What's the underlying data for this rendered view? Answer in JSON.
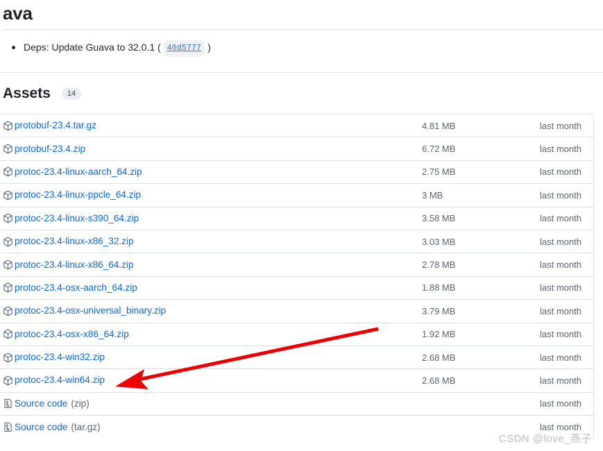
{
  "release_notes": {
    "title": "ava",
    "items": [
      {
        "text": "Deps: Update Guava to 32.0.1",
        "open_paren": "(",
        "commit": "40d5777",
        "close_paren": ")"
      }
    ]
  },
  "assets": {
    "heading": "Assets",
    "count": "14",
    "rows": [
      {
        "icon": "package-icon",
        "name": "protobuf-23.4.tar.gz",
        "suffix": "",
        "size": "4.81 MB",
        "date": "last month"
      },
      {
        "icon": "package-icon",
        "name": "protobuf-23.4.zip",
        "suffix": "",
        "size": "6.72 MB",
        "date": "last month"
      },
      {
        "icon": "package-icon",
        "name": "protoc-23.4-linux-aarch_64.zip",
        "suffix": "",
        "size": "2.75 MB",
        "date": "last month"
      },
      {
        "icon": "package-icon",
        "name": "protoc-23.4-linux-ppcle_64.zip",
        "suffix": "",
        "size": "3 MB",
        "date": "last month"
      },
      {
        "icon": "package-icon",
        "name": "protoc-23.4-linux-s390_64.zip",
        "suffix": "",
        "size": "3.58 MB",
        "date": "last month"
      },
      {
        "icon": "package-icon",
        "name": "protoc-23.4-linux-x86_32.zip",
        "suffix": "",
        "size": "3.03 MB",
        "date": "last month"
      },
      {
        "icon": "package-icon",
        "name": "protoc-23.4-linux-x86_64.zip",
        "suffix": "",
        "size": "2.78 MB",
        "date": "last month"
      },
      {
        "icon": "package-icon",
        "name": "protoc-23.4-osx-aarch_64.zip",
        "suffix": "",
        "size": "1.88 MB",
        "date": "last month"
      },
      {
        "icon": "package-icon",
        "name": "protoc-23.4-osx-universal_binary.zip",
        "suffix": "",
        "size": "3.79 MB",
        "date": "last month"
      },
      {
        "icon": "package-icon",
        "name": "protoc-23.4-osx-x86_64.zip",
        "suffix": "",
        "size": "1.92 MB",
        "date": "last month"
      },
      {
        "icon": "package-icon",
        "name": "protoc-23.4-win32.zip",
        "suffix": "",
        "size": "2.68 MB",
        "date": "last month"
      },
      {
        "icon": "package-icon",
        "name": "protoc-23.4-win64.zip",
        "suffix": "",
        "size": "2.68 MB",
        "date": "last month"
      },
      {
        "icon": "file-code-icon",
        "name": "Source code",
        "suffix": "(zip)",
        "size": "",
        "date": "last month"
      },
      {
        "icon": "file-code-icon",
        "name": "Source code",
        "suffix": "(tar.gz)",
        "size": "",
        "date": "last month"
      }
    ]
  },
  "annotation": {
    "arrow_color": "#ee0000",
    "points_at": "protoc-23.4-win64.zip"
  },
  "watermark": {
    "text": "CSDN @love_燕子"
  },
  "colors": {
    "link": "#0969da",
    "muted": "#59636e",
    "border": "#d8dee4",
    "badge_bg": "#eaeef2",
    "commit_text": "#2f6fd0"
  }
}
